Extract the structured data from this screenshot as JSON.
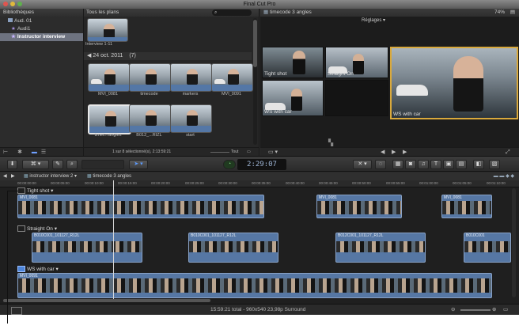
{
  "window": {
    "title": "Final Cut Pro"
  },
  "library": {
    "header": "Bibliothèques",
    "items": [
      {
        "label": "Aud. 01"
      },
      {
        "label": "Audi1"
      },
      {
        "label": "Instructor interview"
      }
    ]
  },
  "browser": {
    "filter": "Tous les plans",
    "top_clip_label": "Interview 1-11",
    "date_group": "24 oct. 2011",
    "date_count": "(7)",
    "clips": [
      {
        "label": "MVI_0081"
      },
      {
        "label": "timecode"
      },
      {
        "label": "markers"
      },
      {
        "label": "MVI_0091"
      },
      {
        "label": "timec...angles"
      },
      {
        "label": "B012_...RIZL"
      },
      {
        "label": "start"
      }
    ],
    "status": "1 sur 8 sélectionné(s), 2:13:59:21",
    "toggle_label": "Tout"
  },
  "viewer": {
    "title": "timecode 3 angles",
    "zoom": "74%",
    "settings_label": "Réglages",
    "angles": [
      {
        "label": "Tight shot"
      },
      {
        "label": "Straight On"
      },
      {
        "label": "WS with car"
      },
      {
        "label": ""
      }
    ],
    "main_label": "WS with car"
  },
  "toolbar": {
    "timecode": "2:29:07"
  },
  "timeline": {
    "breadcrumb_project": "instructor interview 2",
    "breadcrumb_clip": "timecode 3 angles",
    "ruler": [
      "00:00:00:00",
      "00:00:05:00",
      "00:00:10:00",
      "00:00:15:00",
      "00:00:20:00",
      "00:00:25:00",
      "00:00:30:00",
      "00:00:35:00",
      "00:00:40:00",
      "00:00:45:00",
      "00:00:50:00",
      "00:00:55:00",
      "00:01:00:00",
      "00:01:05:00",
      "00:01:10:00",
      "00:01:15:00"
    ],
    "angles": [
      {
        "name": "Tight shot",
        "clips": [
          "MVI_0081",
          "MVI_0081",
          "MVI_0081"
        ]
      },
      {
        "name": "Straight On",
        "clips": [
          "B010C001_101127_R12L",
          "B010C001_101127_R12L",
          "B012C001_101127_R12L",
          "B010C001"
        ]
      },
      {
        "name": "WS with car",
        "clips": [
          "MVI_0091"
        ]
      }
    ],
    "status": "15:59:21 total - 960x540 23,98p Surround"
  }
}
